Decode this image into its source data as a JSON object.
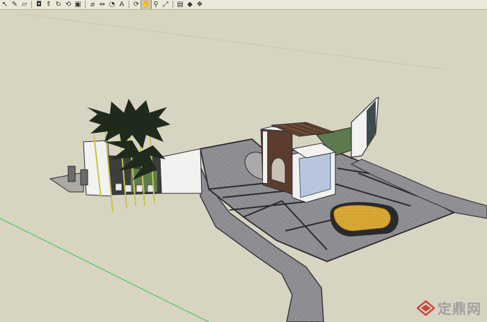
{
  "toolbar": {
    "groups": [
      [
        {
          "name": "select-tool-button",
          "icon": "arrow-cursor-icon",
          "glyph": "↖"
        },
        {
          "name": "pencil-tool-button",
          "icon": "pencil-icon",
          "glyph": "✎"
        },
        {
          "name": "eraser-tool-button",
          "icon": "eraser-icon",
          "glyph": "▱"
        }
      ],
      [
        {
          "name": "paint-bucket-button",
          "icon": "paint-bucket-icon",
          "glyph": "◘"
        },
        {
          "name": "push-pull-button",
          "icon": "push-pull-icon",
          "glyph": "⇑"
        },
        {
          "name": "rotate-tool-button",
          "icon": "rotate-icon",
          "glyph": "↻"
        },
        {
          "name": "follow-me-button",
          "icon": "follow-me-icon",
          "glyph": "⟲"
        },
        {
          "name": "scale-tool-button",
          "icon": "scale-icon",
          "glyph": "▣"
        }
      ],
      [
        {
          "name": "tape-measure-button",
          "icon": "tape-measure-icon",
          "glyph": "⌀"
        },
        {
          "name": "dimension-button",
          "icon": "dimension-icon",
          "glyph": "⇔"
        },
        {
          "name": "protractor-button",
          "icon": "protractor-icon",
          "glyph": "◔"
        },
        {
          "name": "text-tool-button",
          "icon": "text-icon",
          "glyph": "A"
        }
      ],
      [
        {
          "name": "orbit-button",
          "icon": "orbit-icon",
          "glyph": "⟳"
        },
        {
          "name": "pan-button",
          "icon": "hand-icon",
          "glyph": "✋",
          "active": true
        },
        {
          "name": "zoom-button",
          "icon": "magnifier-icon",
          "glyph": "⚲"
        },
        {
          "name": "zoom-extents-button",
          "icon": "zoom-extents-icon",
          "glyph": "⤢"
        }
      ],
      [
        {
          "name": "get-models-button",
          "icon": "warehouse-icon",
          "glyph": "▤"
        },
        {
          "name": "share-model-button",
          "icon": "share-icon",
          "glyph": "◆"
        },
        {
          "name": "components-button",
          "icon": "components-icon",
          "glyph": "❖"
        }
      ]
    ]
  },
  "watermark": {
    "text": "定鼎网",
    "logo_icon": "diamond-logo-icon"
  },
  "colors": {
    "background": "#d8d4c2",
    "paving": "#8f8f94",
    "paving_edge": "#3a3a3c",
    "lawn": "#5d7a4e",
    "yellow_bed": "#d9a935",
    "white_wall": "#f2f2f0",
    "timber": "#5a3d2e",
    "glass": "#b7c6dd",
    "green_axis": "#3cc43c",
    "bamboo_stem": "#c9c24a",
    "bamboo_leaf": "#1f2a1d"
  }
}
